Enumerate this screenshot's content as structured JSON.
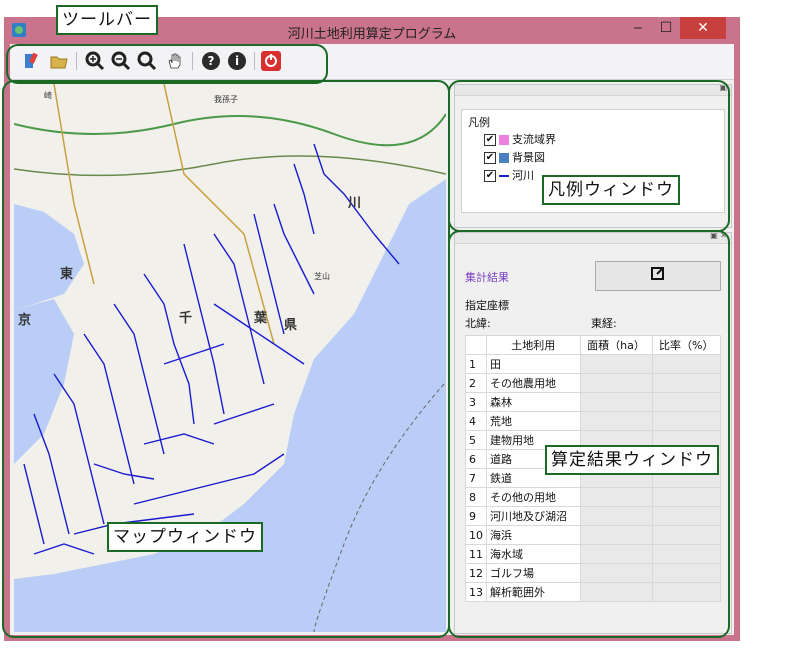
{
  "window": {
    "title": "河川土地利用算定プログラム",
    "min_label": "‒",
    "max_label": "☐",
    "close_label": "✕"
  },
  "toolbar": {
    "buttons": [
      {
        "name": "open-layer-icon",
        "glyph": "🖌"
      },
      {
        "name": "folder-icon",
        "glyph": "📂"
      },
      {
        "name": "zoom-in-icon",
        "glyph": "🔍"
      },
      {
        "name": "zoom-out-icon",
        "glyph": "🔍"
      },
      {
        "name": "zoom-extent-icon",
        "glyph": "🔍"
      },
      {
        "name": "pan-hand-icon",
        "glyph": "✋"
      },
      {
        "name": "help-icon",
        "glyph": "?"
      },
      {
        "name": "info-icon",
        "glyph": "i"
      },
      {
        "name": "exit-icon",
        "glyph": "⏻"
      }
    ]
  },
  "legend": {
    "title": "凡例",
    "items": [
      {
        "label": "支流域界",
        "checked": "✔",
        "color": "#f080e0"
      },
      {
        "label": "背景図",
        "checked": "✔",
        "color": "#4a7fc0"
      },
      {
        "label": "河川",
        "checked": "✔",
        "color": "#1a1ad0"
      }
    ]
  },
  "results": {
    "label": "集計結果",
    "export_icon": "export-icon",
    "coord_title": "指定座標",
    "lat_label": "北緯:",
    "lon_label": "東経:",
    "columns": [
      "土地利用",
      "面積（ha）",
      "比率（%）"
    ],
    "rows": [
      {
        "no": "1",
        "name": "田"
      },
      {
        "no": "2",
        "name": "その他農用地"
      },
      {
        "no": "3",
        "name": "森林"
      },
      {
        "no": "4",
        "name": "荒地"
      },
      {
        "no": "5",
        "name": "建物用地"
      },
      {
        "no": "6",
        "name": "道路"
      },
      {
        "no": "7",
        "name": "鉄道"
      },
      {
        "no": "8",
        "name": "その他の用地"
      },
      {
        "no": "9",
        "name": "河川地及び湖沼"
      },
      {
        "no": "10",
        "name": "海浜"
      },
      {
        "no": "11",
        "name": "海水域"
      },
      {
        "no": "12",
        "name": "ゴルフ場"
      },
      {
        "no": "13",
        "name": "解析範囲外"
      }
    ]
  },
  "map": {
    "labels": [
      "東",
      "京",
      "千",
      "葉",
      "県",
      "川",
      "崎",
      "芝山",
      "我孫子"
    ]
  },
  "annotations": {
    "toolbar": "ツールバー",
    "legend": "凡例ウィンドウ",
    "results": "算定結果ウィンドウ",
    "map": "マップウィンドウ"
  }
}
